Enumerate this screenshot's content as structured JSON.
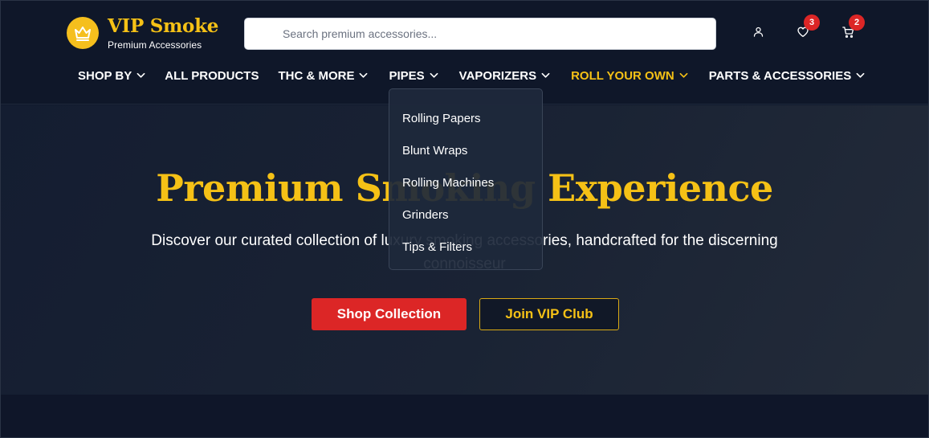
{
  "brand": {
    "name": "VIP Smoke",
    "tagline": "Premium Accessories",
    "accent_color": "#f5c116",
    "logo_icon": "crown-icon"
  },
  "search": {
    "placeholder": "Search premium accessories...",
    "value": ""
  },
  "header_actions": {
    "account_icon": "user-icon",
    "wishlist_icon": "heart-icon",
    "wishlist_count": "3",
    "cart_icon": "cart-icon",
    "cart_count": "2",
    "badge_color": "#dc2626"
  },
  "nav": {
    "items": [
      {
        "label": "SHOP BY",
        "has_dropdown": true
      },
      {
        "label": "ALL PRODUCTS",
        "has_dropdown": false
      },
      {
        "label": "THC & MORE",
        "has_dropdown": true
      },
      {
        "label": "PIPES",
        "has_dropdown": true
      },
      {
        "label": "VAPORIZERS",
        "has_dropdown": true
      },
      {
        "label": "ROLL YOUR OWN",
        "has_dropdown": true,
        "active": true
      },
      {
        "label": "PARTS & ACCESSORIES",
        "has_dropdown": true
      }
    ]
  },
  "dropdown": {
    "parent": "ROLL YOUR OWN",
    "items": [
      {
        "label": "Rolling Papers"
      },
      {
        "label": "Blunt Wraps"
      },
      {
        "label": "Rolling Machines"
      },
      {
        "label": "Grinders"
      },
      {
        "label": "Tips & Filters"
      }
    ]
  },
  "hero": {
    "title": "Premium Smoking Experience",
    "subtitle": "Discover our curated collection of luxury smoking accessories, handcrafted for the discerning connoisseur",
    "primary_cta": "Shop Collection",
    "secondary_cta": "Join VIP Club",
    "primary_color": "#dc2626"
  }
}
